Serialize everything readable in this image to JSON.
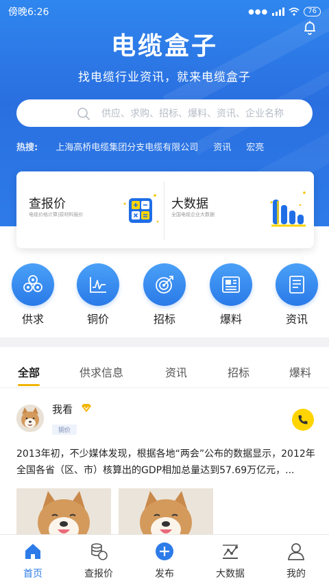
{
  "status_bar": {
    "time": "傍晚6:26",
    "battery": "76"
  },
  "header": {
    "title": "电缆盒子",
    "slogan": "找电缆行业资讯，就来电缆盒子"
  },
  "search": {
    "placeholder": "供应、求购、招标、爆料、资讯、企业名称"
  },
  "hot_search": {
    "label": "热搜:",
    "keywords": [
      "上海高桥电缆集团分支电缆有限公司",
      "资讯",
      "宏亮"
    ]
  },
  "features": [
    {
      "title": "查报价",
      "subtitle": "电缆价格计算|原材料报价"
    },
    {
      "title": "大数据",
      "subtitle": "全国电缆企业大数据"
    }
  ],
  "categories": [
    "供求",
    "铜价",
    "招标",
    "爆料",
    "资讯"
  ],
  "tabs": [
    "全部",
    "供求信息",
    "资讯",
    "招标",
    "爆料"
  ],
  "post": {
    "username": "我看",
    "tag": "铜价",
    "text": "2013年初，不少媒体发现，根据各地“两会”公布的数据显示，2012年全国各省（区、市）核算出的GDP相加总量达到57.69万亿元，..."
  },
  "bottom_nav": [
    "首页",
    "查报价",
    "发布",
    "大数据",
    "我的"
  ],
  "colors": {
    "primary": "#2d7be9",
    "accent": "#f0b400",
    "call": "#ffd400"
  }
}
